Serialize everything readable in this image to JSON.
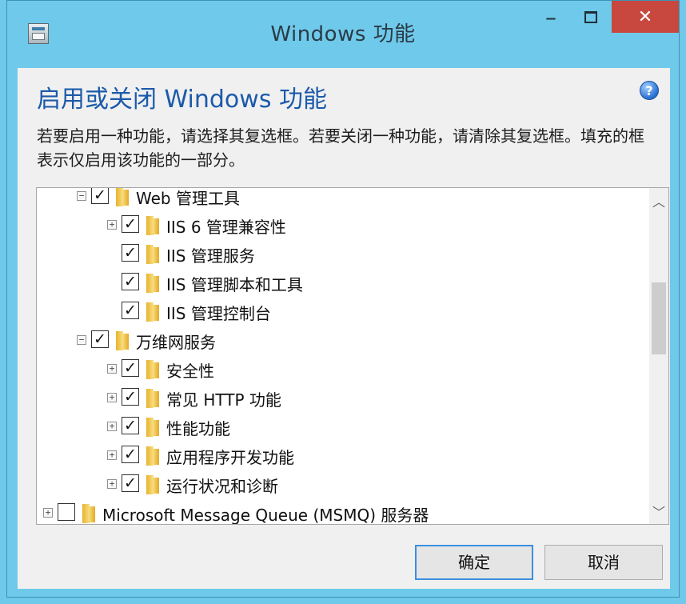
{
  "window": {
    "title": "Windows 功能",
    "minimize_glyph": "–",
    "close_glyph": "✕"
  },
  "header": {
    "heading": "启用或关闭 Windows 功能",
    "help_glyph": "?"
  },
  "description": "若要启用一种功能，请选择其复选框。若要关闭一种功能，请清除其复选框。填充的框表示仅启用该功能的一部分。",
  "tree": {
    "items": [
      {
        "label": "Web 管理工具",
        "expander": "−",
        "checked": true
      },
      {
        "label": "IIS 6 管理兼容性",
        "expander": "+",
        "checked": true
      },
      {
        "label": "IIS 管理服务",
        "expander": "",
        "checked": true
      },
      {
        "label": "IIS 管理脚本和工具",
        "expander": "",
        "checked": true
      },
      {
        "label": "IIS 管理控制台",
        "expander": "",
        "checked": true
      },
      {
        "label": "万维网服务",
        "expander": "−",
        "checked": true
      },
      {
        "label": "安全性",
        "expander": "+",
        "checked": true
      },
      {
        "label": "常见 HTTP 功能",
        "expander": "+",
        "checked": true
      },
      {
        "label": "性能功能",
        "expander": "+",
        "checked": true
      },
      {
        "label": "应用程序开发功能",
        "expander": "+",
        "checked": true
      },
      {
        "label": "运行状况和诊断",
        "expander": "+",
        "checked": true
      },
      {
        "label": "Microsoft Message Queue (MSMQ) 服务器",
        "expander": "+",
        "checked": false
      }
    ],
    "check_glyph": "✓"
  },
  "scrollbar": {
    "up_glyph": "︿",
    "down_glyph": "﹀"
  },
  "buttons": {
    "ok": "确定",
    "cancel": "取消"
  },
  "colors": {
    "frame": "#6fc9ea",
    "close_button": "#c8473f",
    "heading": "#1b5aaa",
    "default_button_border": "#3c8fe0"
  }
}
